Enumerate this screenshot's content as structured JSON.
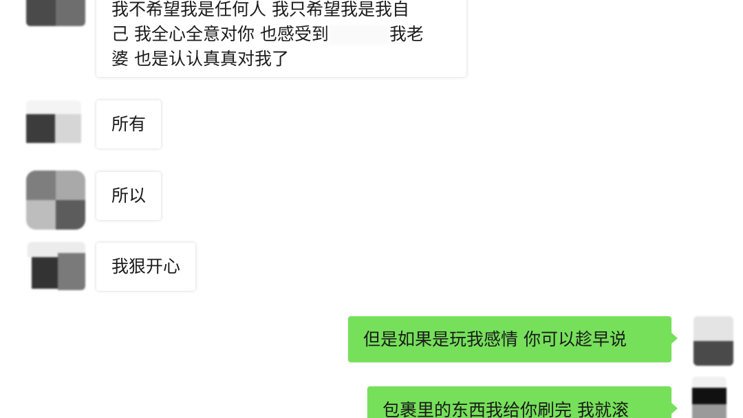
{
  "messages": [
    {
      "direction": "incoming",
      "lines": [
        "我不希望我是任何人 我只希望我是我自",
        "己 我全心全意对你 也感受到",
        "我老",
        "婆 也是认认真真对我了"
      ]
    },
    {
      "direction": "incoming",
      "text": "所有"
    },
    {
      "direction": "incoming",
      "text": "所以"
    },
    {
      "direction": "incoming",
      "text": "我狠开心"
    },
    {
      "direction": "outgoing",
      "text": "但是如果是玩我感情 你可以趁早说"
    },
    {
      "direction": "outgoing",
      "text": "包裹里的东西我给你刷完 我就滚"
    }
  ],
  "colors": {
    "background": "#ffffff",
    "incoming_bubble": "#ffffff",
    "outgoing_bubble": "#76e05a",
    "text": "#1a1a1a"
  },
  "icons": {
    "avatar": "blurred-avatar-icon"
  }
}
